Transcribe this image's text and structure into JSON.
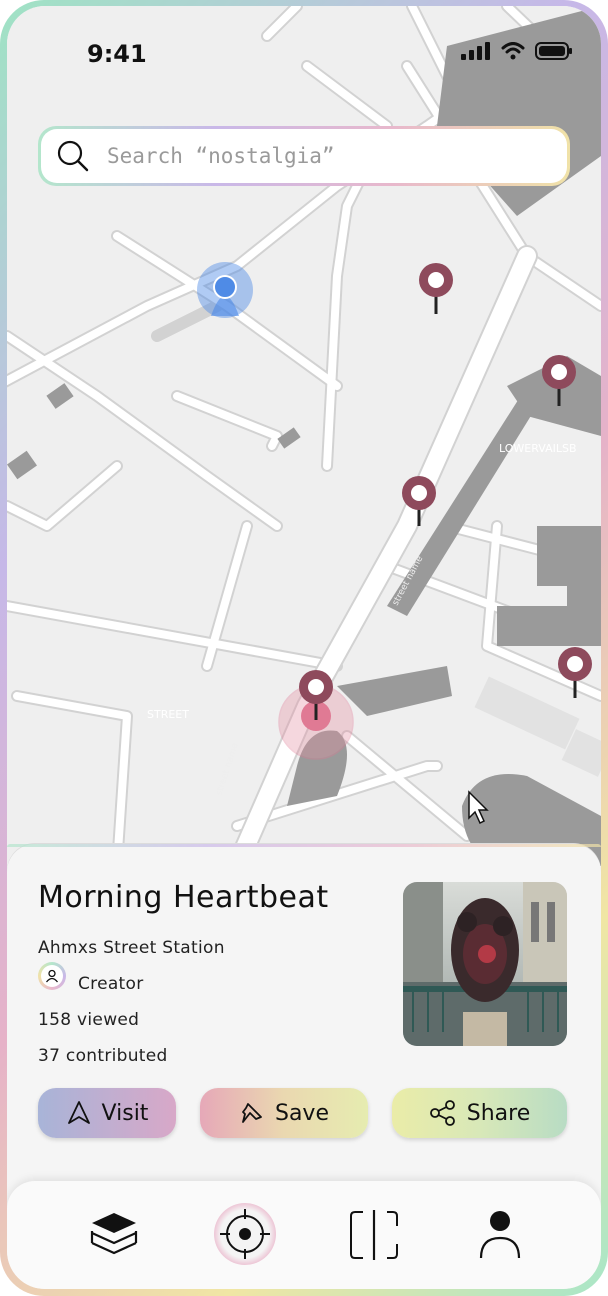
{
  "status_bar": {
    "time": "9:41",
    "icons": [
      "signal-icon",
      "wifi-icon",
      "battery-icon"
    ]
  },
  "search": {
    "placeholder": "Search “nostalgia”",
    "value": ""
  },
  "map": {
    "street_labels": [
      "LOWERVAILSB",
      "street name",
      "STREET",
      "street name"
    ],
    "pins": [
      "pin",
      "pin",
      "pin",
      "pin",
      "pin (selected)"
    ]
  },
  "card": {
    "title": "Morning Heartbeat",
    "location": "Ahmxs Street Station",
    "creator_label": "Creator",
    "viewed": "158 viewed",
    "contributed": "37 contributed"
  },
  "actions": {
    "visit_label": "Visit",
    "save_label": "Save",
    "share_label": "Share"
  },
  "tabs": [
    "layers-tab",
    "explore-tab",
    "scan-tab",
    "profile-tab"
  ],
  "colors": {
    "accent_pin": "#8e4a5c",
    "user_location": "#4f8be6",
    "map_building": "#9a9a9a",
    "map_road": "#ffffff"
  }
}
